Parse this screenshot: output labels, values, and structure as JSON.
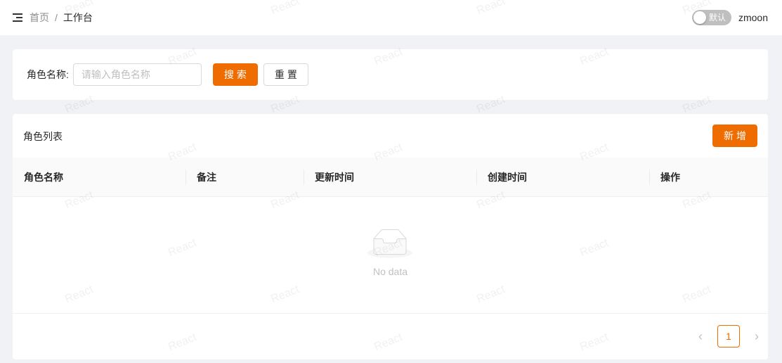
{
  "header": {
    "breadcrumb_home": "首页",
    "breadcrumb_sep": "/",
    "breadcrumb_current": "工作台",
    "theme_switch_label": "默认",
    "username": "zmoon"
  },
  "search": {
    "label": "角色名称:",
    "placeholder": "请输入角色名称",
    "search_button": "搜索",
    "reset_button": "重置"
  },
  "table_card": {
    "title": "角色列表",
    "add_button": "新增",
    "columns": [
      "角色名称",
      "备注",
      "更新时间",
      "创建时间",
      "操作"
    ],
    "empty_text": "No data"
  },
  "pagination": {
    "prev_icon": "‹",
    "current_page": "1",
    "next_icon": "›"
  },
  "watermark": {
    "text": "React",
    "color": "rgba(0,0,0,0.06)"
  },
  "theme": {
    "accent": "#ef6c00"
  }
}
